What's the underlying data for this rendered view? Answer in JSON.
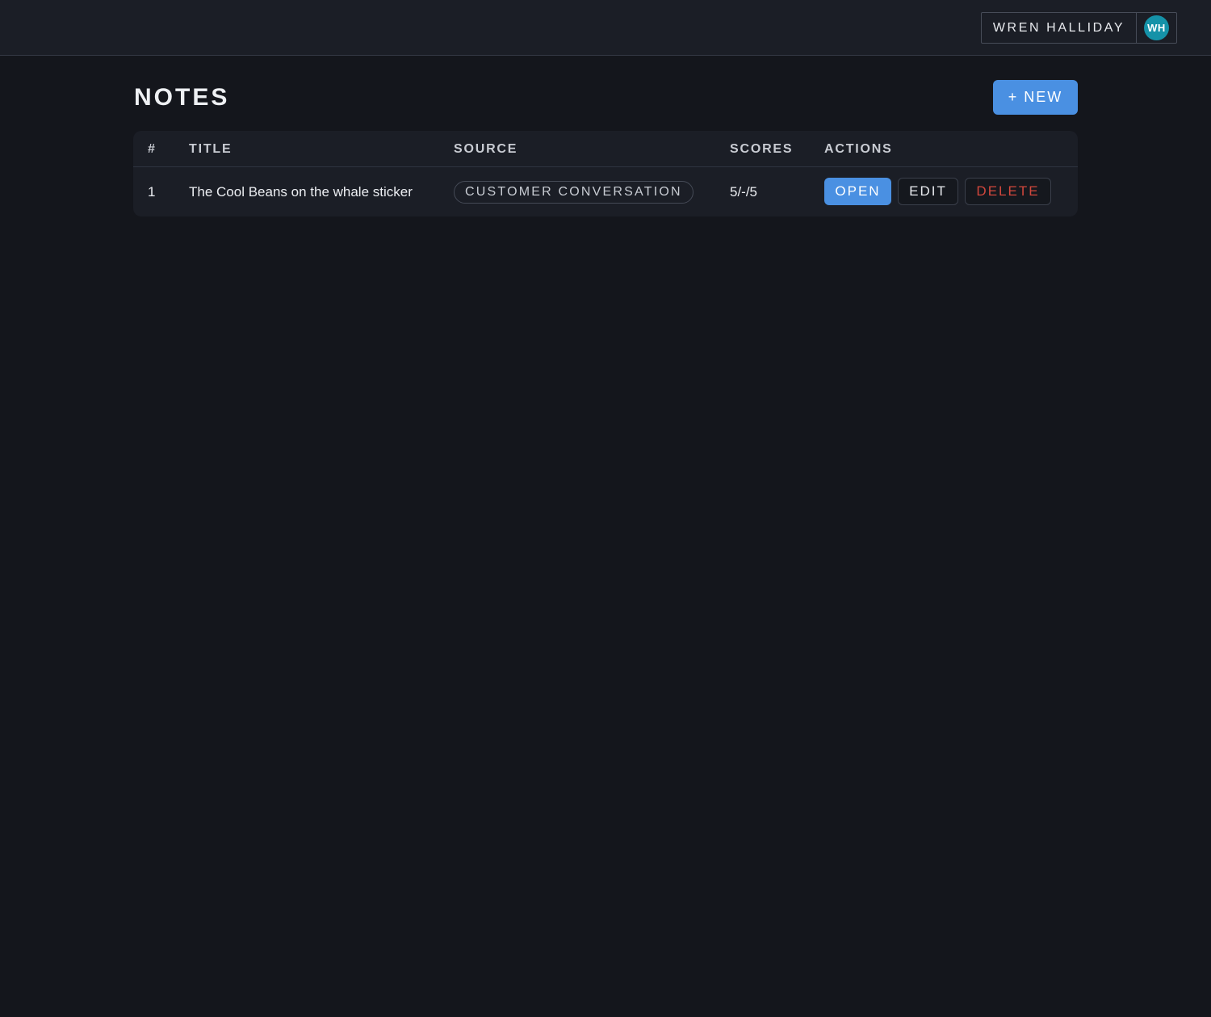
{
  "header": {
    "user_name": "WREN HALLIDAY",
    "avatar_initials": "WH",
    "avatar_color": "#1592a8"
  },
  "page": {
    "title": "NOTES",
    "new_button_label": "+ NEW"
  },
  "table": {
    "columns": {
      "num": "#",
      "title": "TITLE",
      "source": "SOURCE",
      "scores": "SCORES",
      "actions": "ACTIONS"
    },
    "rows": [
      {
        "num": "1",
        "title": "The Cool Beans on the whale sticker",
        "source": "CUSTOMER CONVERSATION",
        "scores": "5/-/5",
        "actions": {
          "open": "OPEN",
          "edit": "EDIT",
          "delete": "DELETE"
        }
      }
    ]
  },
  "colors": {
    "accent": "#4a90e2",
    "danger": "#d2473c",
    "background": "#14161c"
  }
}
